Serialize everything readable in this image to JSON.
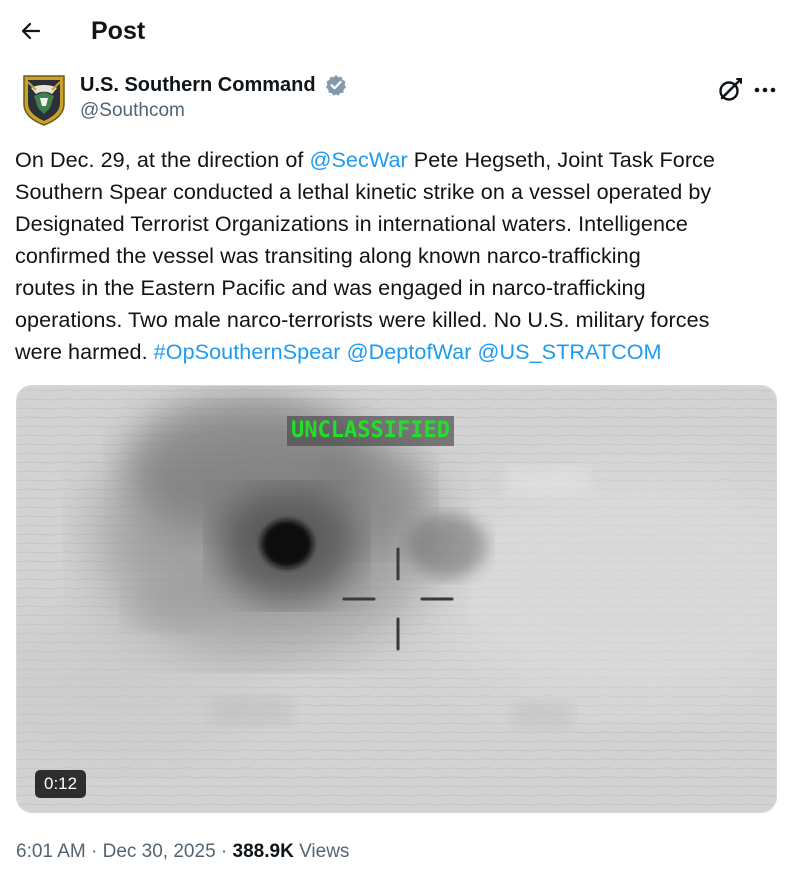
{
  "header": {
    "title": "Post",
    "back_icon": "arrow-left-icon"
  },
  "author": {
    "name": "U.S. Southern Command",
    "handle": "@Southcom",
    "verified_color": "#829aab",
    "avatar_icon": "southcom-seal-icon"
  },
  "actions": {
    "grok_icon": "grok-icon",
    "more_icon": "more-horizontal-icon"
  },
  "post": {
    "l1_a": "On Dec. 29, at the direction of ",
    "l1_link": "@SecWar",
    "l1_b": " Pete Hegseth, Joint Task Force",
    "l2": "Southern Spear conducted a lethal kinetic strike on a vessel operated by",
    "l3": "Designated Terrorist Organizations in international waters. Intelligence",
    "l4": "confirmed the vessel was transiting along known narco-trafficking",
    "l5": "routes in the Eastern Pacific and was engaged in narco-trafficking",
    "l6": "operations. Two male narco-terrorists were killed. No U.S. military forces",
    "l7_a": "were harmed. ",
    "hashtag": "#OpSouthernSpear",
    "mention_war": "@DeptofWar",
    "mention_stratcom": "@US_STRATCOM"
  },
  "media": {
    "overlay_text": "UNCLASSIFIED",
    "overlay_color": "#21e02a",
    "duration": "0:12"
  },
  "meta": {
    "time": "6:01 AM",
    "sep1": " · ",
    "date": "Dec 30, 2025",
    "sep2": " · ",
    "views_count": "388.9K",
    "views_label": " Views"
  },
  "colors": {
    "link": "#1d9bf0",
    "text": "#0f1419",
    "muted": "#536471"
  }
}
